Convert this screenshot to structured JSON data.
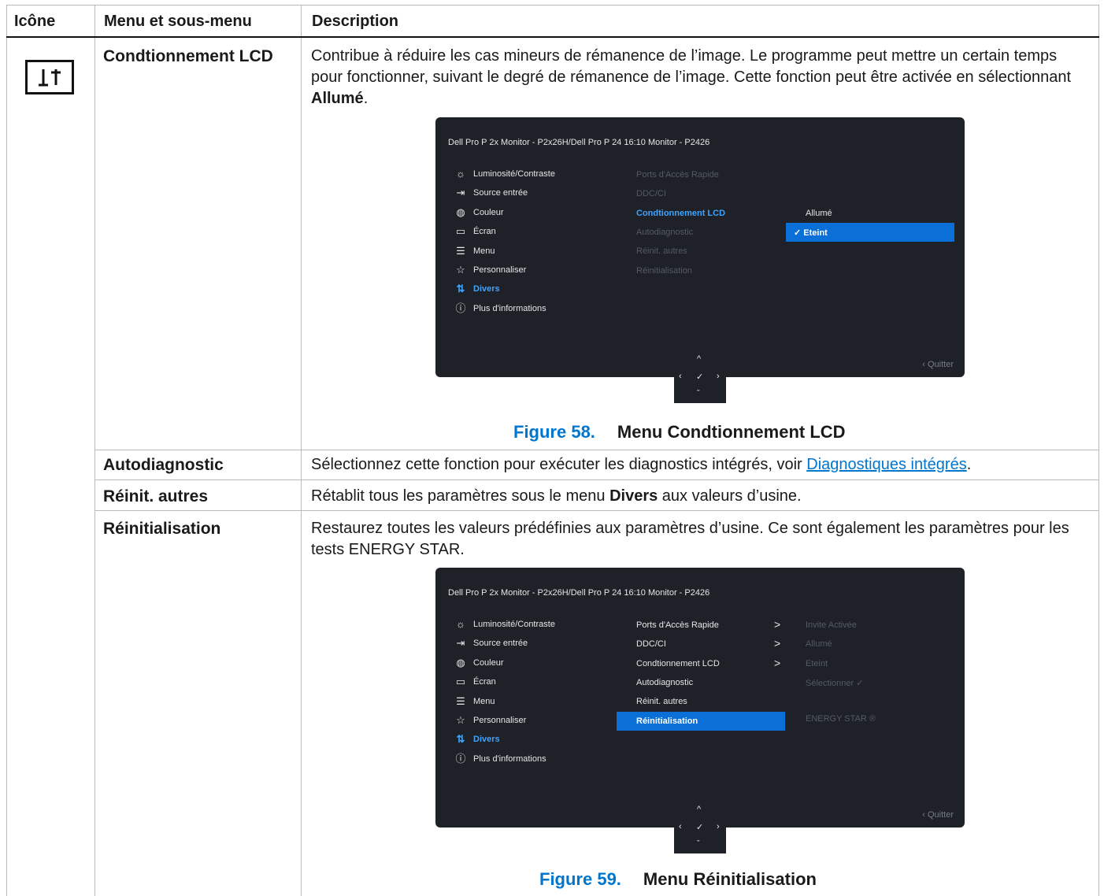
{
  "headers": {
    "icon": "Icône",
    "menu": "Menu et sous-menu",
    "description": "Description"
  },
  "rows": {
    "lcd": {
      "menu": "Condtionnement LCD",
      "desc_1": "Contribue à réduire les cas mineurs de rémanence de l’image. Le programme peut mettre un certain temps pour fonctionner, suivant le degré de rémanence de l’image. Cette fonction peut être activée en sélectionnant ",
      "desc_bold": "Allumé",
      "desc_end": "."
    },
    "autodiag": {
      "menu": "Autodiagnostic",
      "desc_1": "Sélectionnez cette fonction pour exécuter les diagnostics intégrés, voir ",
      "desc_link": "Diagnostiques intégrés",
      "desc_end": "."
    },
    "reinit_autres": {
      "menu": "Réinit. autres",
      "desc_1": "Rétablit tous les paramètres sous le menu ",
      "desc_bold": "Divers",
      "desc_end": " aux valeurs d’usine."
    },
    "reinit": {
      "menu": "Réinitialisation",
      "desc_1": "Restaurez toutes les valeurs prédéfinies aux paramètres d’usine. Ce sont également les paramètres pour les tests ENERGY STAR."
    }
  },
  "osd": {
    "title": "Dell Pro P 2x Monitor - P2x26H/Dell Pro P 24 16:10 Monitor - P2426",
    "main_menu": [
      "Luminosité/Contraste",
      "Source entrée",
      "Couleur",
      "Écran",
      "Menu",
      "Personnaliser",
      "Divers",
      "Plus d'informations"
    ],
    "main_icons": [
      "brightness-icon",
      "input-source-icon",
      "color-icon",
      "display-icon",
      "menu-icon",
      "star-icon",
      "misc-icon",
      "info-icon"
    ],
    "submenu": [
      "Ports d'Accès Rapide",
      "DDC/CI",
      "Condtionnement LCD",
      "Autodiagnostic",
      "Réinit. autres",
      "Réinitialisation"
    ],
    "quit": "Quitter",
    "fig1_options": [
      "Allumé",
      "Eteint"
    ],
    "fig2_values": [
      "Invite Activée",
      "Allumé",
      "Eteint",
      "Sélectionner",
      "ENERGY STAR ®"
    ]
  },
  "figures": {
    "fig58": {
      "num": "Figure 58.",
      "title": "Menu Condtionnement LCD"
    },
    "fig59": {
      "num": "Figure 59.",
      "title": "Menu Réinitialisation"
    }
  },
  "colors": {
    "accent": "#0076ce",
    "osd_bg": "#1e2128",
    "osd_highlight": "#0a6fd6"
  }
}
